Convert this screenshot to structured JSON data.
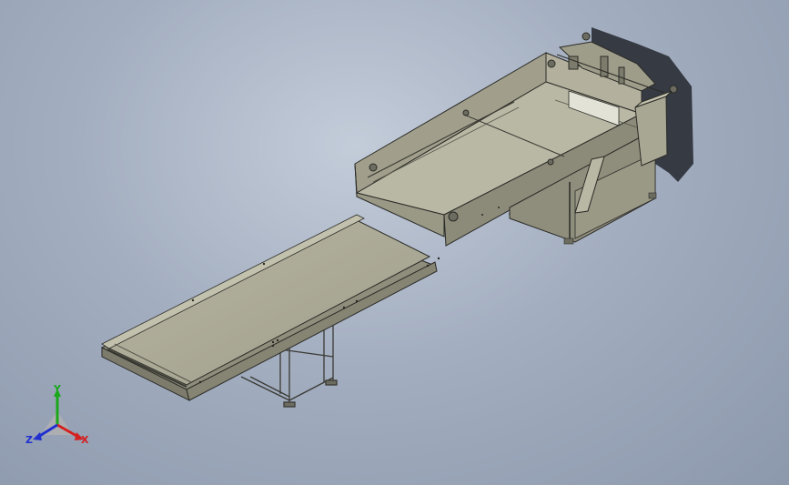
{
  "colors": {
    "background_top": "#c3ccd9",
    "background_bottom": "#8c98ac",
    "model_face": "#a8a794",
    "model_face_light": "#b8b7a3",
    "model_face_dark": "#7d7c6c",
    "model_edge": "#2a2a26",
    "axis_x": "#d42020",
    "axis_y": "#1aa81a",
    "axis_z": "#2030d0"
  },
  "model": {
    "icon": "conveyor-assembly-3d-model"
  },
  "triad": {
    "x_label": "X",
    "y_label": "Y",
    "z_label": "Z"
  }
}
